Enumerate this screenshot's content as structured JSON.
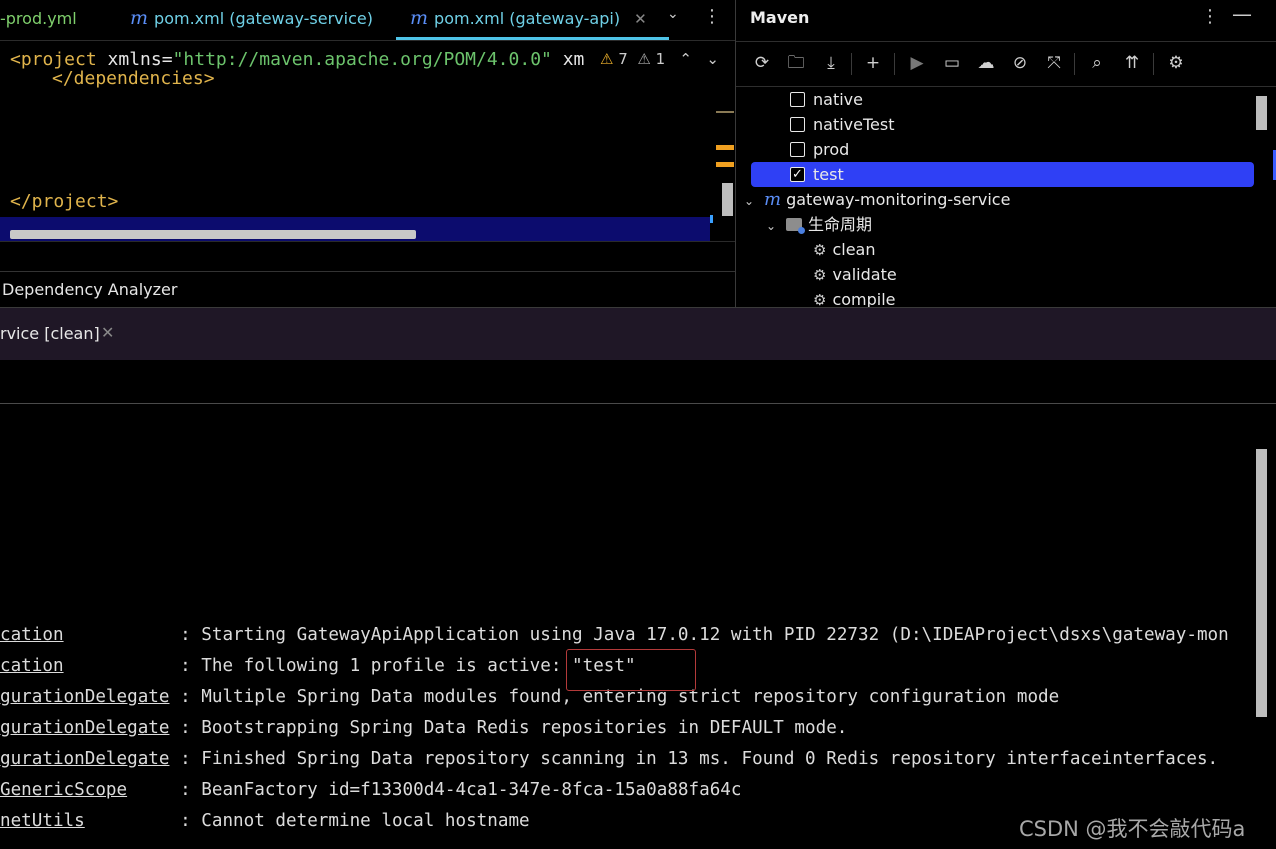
{
  "editor_tabs": {
    "prod": "-prod.yml",
    "gateway_service_icon": "m",
    "gateway_service": "pom.xml (gateway-service)",
    "gateway_api_icon": "m",
    "gateway_api": "pom.xml (gateway-api)",
    "close": "✕",
    "more": "⋮",
    "chevron": "⌄"
  },
  "editor": {
    "line1_tag_open": "<project ",
    "line1_attr": "xmlns",
    "line1_eq": "=",
    "line1_value": "\"http://maven.apache.org/POM/4.0.0\"",
    "line1_tail": " xm",
    "deps_line": "</dependencies>",
    "project_close": "</project>",
    "warnings_count": "7",
    "weak_warnings_count": "1",
    "warn_icon": "⚠",
    "up_arrow": "⌃",
    "down_arrow": "⌄"
  },
  "dependency_analyzer": {
    "label": "Dependency Analyzer"
  },
  "maven": {
    "title": "Maven",
    "more": "⋮",
    "minimize": "—",
    "toolbar": {
      "reload": "⟳",
      "reload_folder": "🗀",
      "download": "⤓",
      "add": "+",
      "run": "▶",
      "run_config": "▭",
      "offline": "☁",
      "skip_tests": "⊘",
      "collapse": "⤧",
      "diagram": "⌕",
      "expand": "⇈",
      "settings": "⚙"
    },
    "tree": [
      {
        "label": "native",
        "checked": false
      },
      {
        "label": "nativeTest",
        "checked": false
      },
      {
        "label": "prod",
        "checked": false
      },
      {
        "label": "test",
        "checked": true
      }
    ],
    "project_icon": "m",
    "project": "gateway-monitoring-service",
    "lifecycle": "生命周期",
    "goals": [
      "clean",
      "validate",
      "compile"
    ],
    "gear_icon": "⚙",
    "chevron": "⌄"
  },
  "run": {
    "tab_label": "rvice [clean]",
    "close": "✕"
  },
  "console": {
    "lines": [
      {
        "logger": "cation",
        "pad": "          ",
        "message": " : Starting GatewayApiApplication using Java 17.0.12 with PID 22732 (D:\\IDEAProject\\dsxs\\gateway-mon"
      },
      {
        "logger": "cation",
        "pad": "          ",
        "message": " : The following 1 profile is active: \"test\""
      },
      {
        "logger": "gurationDelegate",
        "pad": "",
        "message": " : Multiple Spring Data modules found, entering strict repository configuration mode"
      },
      {
        "logger": "gurationDelegate",
        "pad": "",
        "message": " : Bootstrapping Spring Data Redis repositories in DEFAULT mode."
      },
      {
        "logger": "gurationDelegate",
        "pad": "",
        "message": " : Finished Spring Data repository scanning in 13 ms. Found 0 Redis repository interfaceinterfaces."
      },
      {
        "logger": "GenericScope",
        "pad": "    ",
        "message": " : BeanFactory id=f13300d4-4ca1-347e-8fca-15a0a88fa64c"
      },
      {
        "logger": "netUtils",
        "pad": "        ",
        "message": " : Cannot determine local hostname"
      }
    ]
  },
  "watermark": "CSDN @我不会敲代码a",
  "colors": {
    "selection": "#2f40f5",
    "run_tabbar": "#1f1726",
    "highlight_box": "#b33a3a",
    "tab_underline": "#4fc4e8"
  }
}
